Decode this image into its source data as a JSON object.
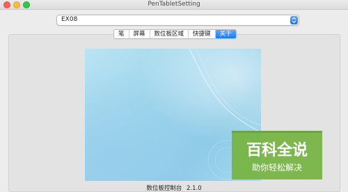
{
  "window": {
    "title": "PenTabletSetting"
  },
  "device_select": {
    "value": "EX08"
  },
  "tabs": [
    {
      "label": "笔"
    },
    {
      "label": "屏幕"
    },
    {
      "label": "数位板区域"
    },
    {
      "label": "快捷键"
    },
    {
      "label": "关于"
    }
  ],
  "active_tab": "关于",
  "about": {
    "app_name": "数位板控制台",
    "version": "2.1.0"
  },
  "watermark": {
    "title": "百科全说",
    "subtitle": "助你轻松解决"
  },
  "colors": {
    "accent": "#1f77f2",
    "watermark_bg": "#78b446"
  }
}
